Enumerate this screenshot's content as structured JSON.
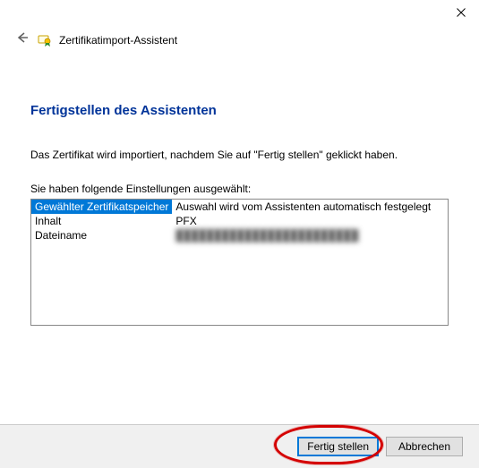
{
  "window": {
    "wizard_title": "Zertifikatimport-Assistent"
  },
  "page": {
    "heading": "Fertigstellen des Assistenten",
    "description": "Das Zertifikat wird importiert, nachdem Sie auf \"Fertig stellen\" geklickt haben.",
    "settings_intro": "Sie haben folgende Einstellungen ausgewählt:"
  },
  "settings": {
    "rows": [
      {
        "key": "Gewählter Zertifikatspeicher",
        "value": "Auswahl wird vom Assistenten automatisch festgelegt",
        "selected": true
      },
      {
        "key": "Inhalt",
        "value": "PFX",
        "selected": false
      },
      {
        "key": "Dateiname",
        "value": "████████████████████████",
        "selected": false,
        "redacted": true
      }
    ]
  },
  "buttons": {
    "finish": "Fertig stellen",
    "cancel": "Abbrechen"
  }
}
